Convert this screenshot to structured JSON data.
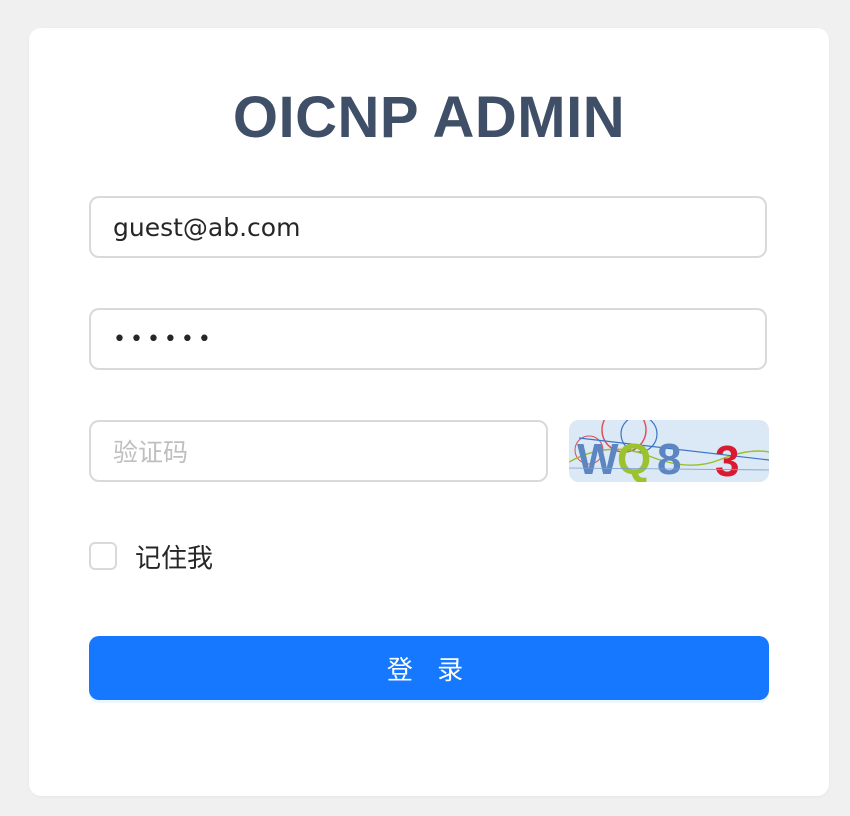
{
  "app": {
    "title": "OICNP ADMIN"
  },
  "form": {
    "email_value": "guest@ab.com",
    "password_value": "••••••",
    "captcha_placeholder": "验证码",
    "captcha_text": "WQ8 3",
    "remember_label": "记住我",
    "submit_label": "登 录"
  },
  "colors": {
    "page_bg": "#f0f0f0",
    "card_bg": "#ffffff",
    "title": "#3f4f67",
    "primary": "#1677ff",
    "border": "#d9d9d9",
    "placeholder": "#bfbfbf"
  }
}
